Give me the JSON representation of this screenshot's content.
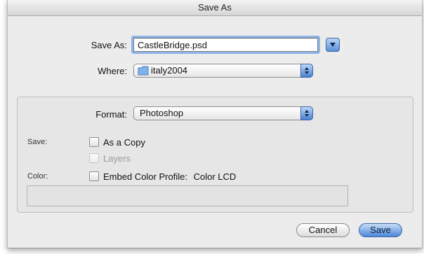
{
  "window": {
    "title": "Save As"
  },
  "save_as": {
    "label": "Save As:",
    "value": "CastleBridge.psd"
  },
  "where": {
    "label": "Where:",
    "value": "italy2004"
  },
  "format": {
    "label": "Format:",
    "value": "Photoshop"
  },
  "options": {
    "save_label": "Save:",
    "as_a_copy": "As a Copy",
    "layers": "Layers",
    "color_label": "Color:",
    "embed_color_profile": "Embed Color Profile:",
    "color_profile_value": "Color LCD"
  },
  "buttons": {
    "cancel": "Cancel",
    "save": "Save"
  },
  "icons": {
    "disclosure": "disclosure-triangle-icon",
    "folder": "folder-icon",
    "popup_arrows": "popup-arrows-icon"
  },
  "colors": {
    "accent": "#4a80cf",
    "focus_ring": "#8fb4e8"
  }
}
